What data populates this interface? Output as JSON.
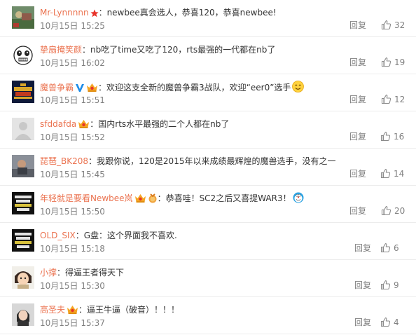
{
  "comments": [
    {
      "user": "Mr-Lynnnnn",
      "badges": [
        "red-star-icon"
      ],
      "text": "：newbee真会选人，恭喜120，恭喜newbee!",
      "time": "10月15日 15:25",
      "reply": "回复",
      "likes": "32",
      "avatar": "landscape-avatar"
    },
    {
      "user": "挚扇掩笑颜",
      "badges": [],
      "text": "：nb吃了time又吃了120，rts最强的一代都在nb了",
      "time": "10月15日 16:02",
      "reply": "回复",
      "likes": "19",
      "avatar": "cartoon-face-avatar"
    },
    {
      "user": "魔兽争霸",
      "badges": [
        "verified-v-icon",
        "vip-crown-icon"
      ],
      "text": "：欢迎这支全新的魔兽争霸3战队，欢迎“eer0”选手",
      "emoji": "smile-emoji-icon",
      "time": "10月15日 15:51",
      "reply": "回复",
      "likes": "12",
      "avatar": "warcraft-logo-avatar"
    },
    {
      "user": "sfddafda",
      "badges": [
        "vip-crown-icon"
      ],
      "text": "：国内rts水平最强的二个人都在nb了",
      "time": "10月15日 15:52",
      "reply": "回复",
      "likes": "16",
      "avatar": "default-gray-avatar"
    },
    {
      "user": "琵琶_BK208",
      "badges": [],
      "text": "：我跟你说，120是2015年以来成绩最辉煌的魔兽选手，没有之一",
      "time": "10月15日 15:45",
      "reply": "回复",
      "likes": "14",
      "avatar": "photo-avatar"
    },
    {
      "user": "年轻就是要看Newbee岚",
      "badges": [
        "vip-crown-icon",
        "medal-icon"
      ],
      "text": "：恭喜哇！SC2之后又喜提WAR3！",
      "emoji": "doraemon-emoji-icon",
      "time": "10月15日 15:50",
      "reply": "回复",
      "likes": "20",
      "avatar": "keep-calm-avatar"
    },
    {
      "user": "OLD_SIX",
      "badges": [],
      "text": "：G盘：这个界面我不喜欢.",
      "time": "10月15日 15:18",
      "reply": "回复",
      "likes": "6",
      "avatar": "keep-calm-avatar"
    },
    {
      "user": "小撑",
      "badges": [],
      "text": "：得逼王者得天下",
      "time": "10月15日 15:30",
      "reply": "回复",
      "likes": "9",
      "avatar": "anime-avatar"
    },
    {
      "user": "高圣夫",
      "badges": [
        "vip-crown-icon"
      ],
      "text": "：逼王牛逼（破音）！！！",
      "time": "10月15日 15:37",
      "reply": "回复",
      "likes": "4",
      "avatar": "portrait-avatar"
    }
  ],
  "colors": {
    "username": "#eb7350",
    "text": "#333333",
    "meta": "#808080",
    "divider": "#ececec",
    "vip": "#f5a623"
  }
}
